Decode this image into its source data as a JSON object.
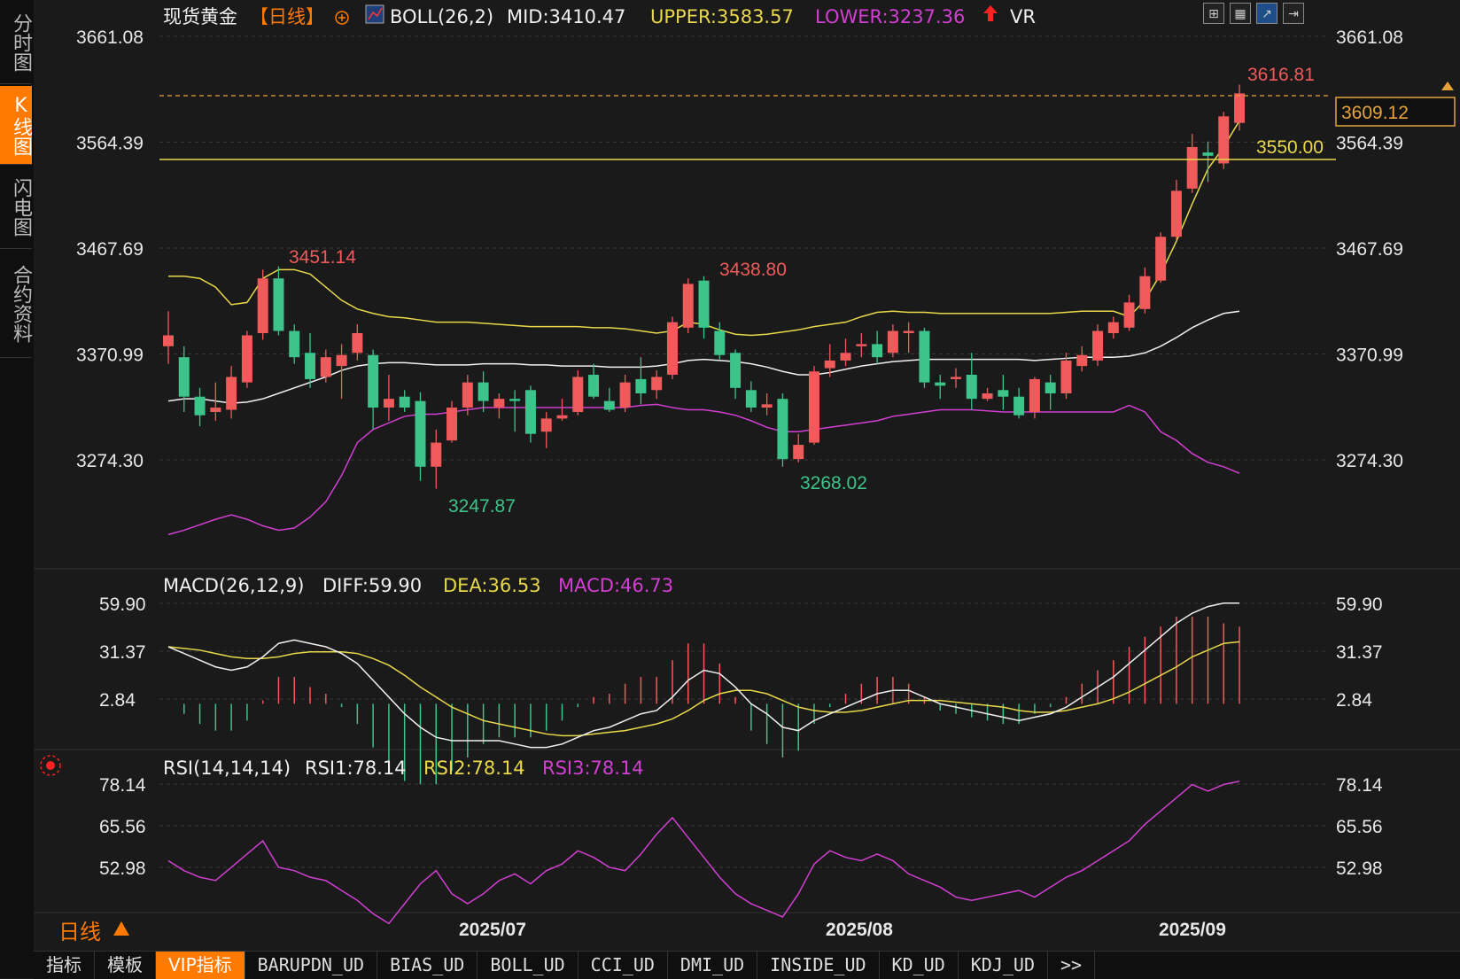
{
  "side_tabs": [
    {
      "label": "分时图",
      "active": false
    },
    {
      "label": "K线图",
      "active": true
    },
    {
      "label": "闪电图",
      "active": false
    },
    {
      "label": "合约资料",
      "active": false
    }
  ],
  "header": {
    "instrument": "现货黄金",
    "period": "【日线】",
    "boll_name": "BOLL(26,2)",
    "mid": "MID:3410.47",
    "upper": "UPPER:3583.57",
    "lower": "LOWER:3237.36",
    "vr": "VR"
  },
  "tool_icons": [
    "grid-icon",
    "table-icon",
    "chart-icon",
    "expand-icon"
  ],
  "main_axis": {
    "ticks": [
      "3661.08",
      "3564.39",
      "3467.69",
      "3370.99",
      "3274.30"
    ],
    "current_price": "3609.12",
    "level_line": "3550.00"
  },
  "annotations": {
    "high_1": "3451.14",
    "high_2": "3438.80",
    "high_3": "3616.81",
    "low_1": "3247.87",
    "low_2": "3268.02"
  },
  "macd": {
    "name": "MACD(26,12,9)",
    "diff": "DIFF:59.90",
    "dea": "DEA:36.53",
    "macd": "MACD:46.73",
    "ticks": [
      "59.90",
      "31.37",
      "2.84"
    ]
  },
  "rsi": {
    "name": "RSI(14,14,14)",
    "rsi1": "RSI1:78.14",
    "rsi2": "RSI2:78.14",
    "rsi3": "RSI3:78.14",
    "ticks": [
      "78.14",
      "65.56",
      "52.98"
    ]
  },
  "x_axis": [
    "2025/07",
    "2025/08",
    "2025/09"
  ],
  "period_label": "日线",
  "bottom_tabs": [
    "指标",
    "模板",
    "VIP指标",
    "BARUPDN_UD",
    "BIAS_UD",
    "BOLL_UD",
    "CCI_UD",
    "DMI_UD",
    "INSIDE_UD",
    "KD_UD",
    "KDJ_UD",
    ">>"
  ],
  "chart_data": {
    "type": "candlestick",
    "ylim": [
      3200,
      3680
    ],
    "candles": [
      [
        3378,
        3388,
        3362,
        3410
      ],
      [
        3368,
        3332,
        3318,
        3378
      ],
      [
        3332,
        3315,
        3305,
        3340
      ],
      [
        3318,
        3322,
        3310,
        3345
      ],
      [
        3320,
        3350,
        3312,
        3360
      ],
      [
        3345,
        3388,
        3340,
        3392
      ],
      [
        3390,
        3440,
        3384,
        3448
      ],
      [
        3440,
        3392,
        3388,
        3451
      ],
      [
        3392,
        3368,
        3362,
        3398
      ],
      [
        3372,
        3348,
        3340,
        3390
      ],
      [
        3350,
        3368,
        3345,
        3375
      ],
      [
        3360,
        3370,
        3330,
        3380
      ],
      [
        3372,
        3390,
        3365,
        3398
      ],
      [
        3370,
        3322,
        3302,
        3375
      ],
      [
        3322,
        3330,
        3310,
        3352
      ],
      [
        3332,
        3322,
        3318,
        3338
      ],
      [
        3328,
        3268,
        3255,
        3336
      ],
      [
        3268,
        3290,
        3248,
        3302
      ],
      [
        3292,
        3322,
        3290,
        3328
      ],
      [
        3322,
        3345,
        3315,
        3352
      ],
      [
        3345,
        3328,
        3318,
        3355
      ],
      [
        3322,
        3330,
        3312,
        3335
      ],
      [
        3330,
        3328,
        3300,
        3338
      ],
      [
        3338,
        3298,
        3290,
        3342
      ],
      [
        3300,
        3312,
        3285,
        3318
      ],
      [
        3312,
        3315,
        3310,
        3330
      ],
      [
        3318,
        3350,
        3315,
        3356
      ],
      [
        3352,
        3332,
        3330,
        3362
      ],
      [
        3328,
        3320,
        3318,
        3340
      ],
      [
        3322,
        3345,
        3318,
        3352
      ],
      [
        3348,
        3335,
        3325,
        3368
      ],
      [
        3338,
        3350,
        3330,
        3356
      ],
      [
        3352,
        3400,
        3348,
        3405
      ],
      [
        3395,
        3435,
        3390,
        3440
      ],
      [
        3438,
        3395,
        3385,
        3442
      ],
      [
        3392,
        3370,
        3366,
        3400
      ],
      [
        3372,
        3340,
        3330,
        3375
      ],
      [
        3338,
        3322,
        3318,
        3346
      ],
      [
        3322,
        3325,
        3315,
        3335
      ],
      [
        3330,
        3275,
        3268,
        3335
      ],
      [
        3275,
        3288,
        3272,
        3298
      ],
      [
        3290,
        3355,
        3288,
        3360
      ],
      [
        3358,
        3365,
        3350,
        3380
      ],
      [
        3365,
        3372,
        3360,
        3385
      ],
      [
        3378,
        3380,
        3368,
        3390
      ],
      [
        3380,
        3368,
        3362,
        3392
      ],
      [
        3372,
        3392,
        3368,
        3398
      ],
      [
        3390,
        3392,
        3372,
        3400
      ],
      [
        3392,
        3345,
        3340,
        3395
      ],
      [
        3345,
        3342,
        3330,
        3352
      ],
      [
        3348,
        3350,
        3340,
        3358
      ],
      [
        3352,
        3330,
        3320,
        3372
      ],
      [
        3330,
        3335,
        3328,
        3340
      ],
      [
        3338,
        3332,
        3320,
        3352
      ],
      [
        3332,
        3315,
        3312,
        3340
      ],
      [
        3318,
        3348,
        3312,
        3350
      ],
      [
        3345,
        3335,
        3320,
        3352
      ],
      [
        3335,
        3365,
        3330,
        3372
      ],
      [
        3360,
        3370,
        3355,
        3378
      ],
      [
        3365,
        3392,
        3360,
        3398
      ],
      [
        3390,
        3400,
        3385,
        3405
      ],
      [
        3395,
        3418,
        3392,
        3425
      ],
      [
        3412,
        3442,
        3408,
        3450
      ],
      [
        3438,
        3478,
        3436,
        3482
      ],
      [
        3478,
        3520,
        3475,
        3530
      ],
      [
        3522,
        3560,
        3518,
        3572
      ],
      [
        3555,
        3552,
        3528,
        3565
      ],
      [
        3545,
        3588,
        3540,
        3592
      ],
      [
        3582,
        3609,
        3575,
        3617
      ]
    ],
    "boll": {
      "upper": [
        3442,
        3442,
        3440,
        3432,
        3416,
        3418,
        3440,
        3448,
        3448,
        3444,
        3432,
        3420,
        3412,
        3408,
        3405,
        3404,
        3402,
        3400,
        3400,
        3400,
        3399,
        3398,
        3397,
        3396,
        3396,
        3396,
        3396,
        3395,
        3395,
        3394,
        3392,
        3390,
        3392,
        3400,
        3398,
        3393,
        3389,
        3388,
        3389,
        3391,
        3393,
        3396,
        3398,
        3400,
        3405,
        3409,
        3410,
        3409,
        3409,
        3408,
        3408,
        3408,
        3408,
        3408,
        3408,
        3408,
        3408,
        3409,
        3410,
        3410,
        3410,
        3405,
        3420,
        3444,
        3474,
        3508,
        3540,
        3560,
        3584
      ],
      "mid": [
        3328,
        3330,
        3330,
        3328,
        3326,
        3327,
        3330,
        3335,
        3340,
        3345,
        3350,
        3356,
        3360,
        3362,
        3363,
        3363,
        3362,
        3361,
        3361,
        3361,
        3362,
        3362,
        3362,
        3361,
        3361,
        3360,
        3360,
        3360,
        3359,
        3359,
        3359,
        3360,
        3362,
        3365,
        3366,
        3365,
        3364,
        3362,
        3359,
        3355,
        3352,
        3352,
        3354,
        3357,
        3360,
        3362,
        3364,
        3365,
        3366,
        3366,
        3366,
        3366,
        3366,
        3366,
        3366,
        3365,
        3366,
        3367,
        3368,
        3368,
        3368,
        3369,
        3372,
        3378,
        3386,
        3395,
        3402,
        3408,
        3410
      ],
      "lower": [
        3206,
        3210,
        3215,
        3220,
        3224,
        3220,
        3214,
        3210,
        3212,
        3222,
        3236,
        3260,
        3290,
        3302,
        3308,
        3314,
        3316,
        3316,
        3318,
        3320,
        3322,
        3322,
        3322,
        3322,
        3322,
        3322,
        3322,
        3322,
        3322,
        3322,
        3324,
        3325,
        3322,
        3320,
        3320,
        3318,
        3315,
        3310,
        3304,
        3300,
        3300,
        3302,
        3304,
        3306,
        3308,
        3310,
        3314,
        3316,
        3318,
        3320,
        3320,
        3320,
        3319,
        3318,
        3318,
        3318,
        3318,
        3318,
        3318,
        3318,
        3318,
        3324,
        3318,
        3300,
        3292,
        3280,
        3272,
        3268,
        3262
      ]
    },
    "macd": {
      "diff": [
        34,
        30,
        26,
        22,
        20,
        22,
        28,
        36,
        38,
        36,
        34,
        30,
        24,
        14,
        4,
        -6,
        -14,
        -20,
        -22,
        -22,
        -22,
        -22,
        -24,
        -26,
        -26,
        -24,
        -20,
        -16,
        -14,
        -10,
        -6,
        -4,
        4,
        14,
        20,
        18,
        10,
        0,
        -6,
        -14,
        -16,
        -10,
        -6,
        -2,
        2,
        6,
        8,
        8,
        4,
        0,
        -2,
        -4,
        -6,
        -8,
        -10,
        -8,
        -6,
        -2,
        4,
        10,
        16,
        24,
        32,
        40,
        48,
        54,
        58,
        60,
        60
      ],
      "dea": [
        34,
        33,
        32,
        30,
        28,
        27,
        27,
        28,
        30,
        31,
        31,
        31,
        30,
        27,
        23,
        17,
        10,
        4,
        -2,
        -6,
        -10,
        -12,
        -14,
        -16,
        -18,
        -19,
        -19,
        -18,
        -17,
        -16,
        -14,
        -12,
        -9,
        -4,
        2,
        6,
        8,
        8,
        6,
        2,
        -2,
        -4,
        -5,
        -5,
        -4,
        -2,
        0,
        2,
        2,
        2,
        1,
        0,
        -1,
        -2,
        -4,
        -5,
        -5,
        -4,
        -2,
        0,
        3,
        7,
        12,
        17,
        22,
        28,
        32,
        36,
        37
      ],
      "bar": [
        0,
        -6,
        -12,
        -16,
        -16,
        -10,
        2,
        16,
        16,
        10,
        6,
        -2,
        -12,
        -26,
        -38,
        -46,
        -48,
        -48,
        -40,
        -32,
        -24,
        -20,
        -20,
        -20,
        -16,
        -10,
        -2,
        4,
        6,
        12,
        16,
        16,
        26,
        36,
        36,
        24,
        4,
        -16,
        -24,
        -32,
        -28,
        -12,
        -2,
        6,
        12,
        16,
        16,
        12,
        4,
        -4,
        -6,
        -8,
        -10,
        -12,
        -12,
        -6,
        -2,
        4,
        12,
        20,
        26,
        34,
        40,
        46,
        52,
        52,
        52,
        48,
        46
      ]
    },
    "rsi": [
      55,
      52,
      50,
      49,
      53,
      57,
      61,
      53,
      52,
      50,
      49,
      46,
      43,
      39,
      36,
      42,
      48,
      52,
      45,
      42,
      45,
      49,
      51,
      48,
      52,
      54,
      58,
      56,
      53,
      52,
      57,
      63,
      68,
      62,
      56,
      50,
      45,
      42,
      40,
      38,
      45,
      54,
      58,
      56,
      55,
      57,
      55,
      51,
      49,
      47,
      44,
      43,
      44,
      45,
      46,
      44,
      47,
      50,
      52,
      55,
      58,
      61,
      66,
      70,
      74,
      78,
      76,
      78,
      79
    ]
  }
}
